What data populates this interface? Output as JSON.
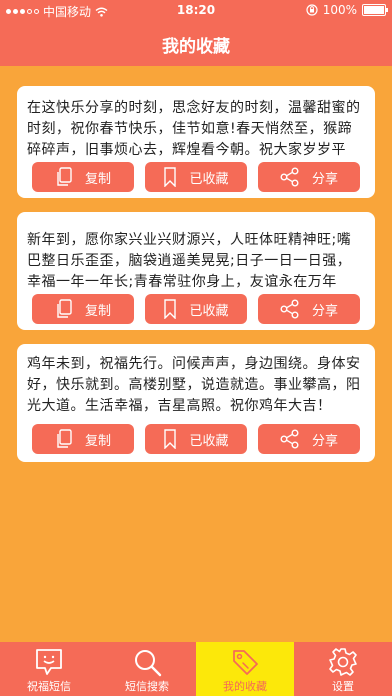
{
  "status_bar": {
    "carrier": "中国移动",
    "time": "18:20",
    "battery": "100%",
    "battery_level": 1.0
  },
  "nav": {
    "title": "我的收藏"
  },
  "cards": [
    {
      "text": "在这快乐分享的时刻，思念好友的时刻，温馨甜蜜的时刻，祝你春节快乐，佳节如意!春天悄然至，猴蹄碎碎声，旧事烦心去，辉煌看今朝。祝大家岁岁平安！",
      "copy_label": "复制",
      "collected_label": "已收藏",
      "share_label": "分享"
    },
    {
      "text": "新年到，愿你家兴业兴财源兴，人旺体旺精神旺;嘴巴整日乐歪歪，脑袋逍遥美晃晃;日子一日一日强，幸福一年一年长;青春常驻你身上，友谊永在万年长。",
      "copy_label": "复制",
      "collected_label": "已收藏",
      "share_label": "分享"
    },
    {
      "text": " 鸡年未到，祝福先行。问候声声，身边围绕。身体安好，快乐就到。高楼别墅，说造就造。事业攀高，阳光大道。生活幸福，吉星高照。祝你鸡年大吉！",
      "copy_label": "复制",
      "collected_label": "已收藏",
      "share_label": "分享"
    }
  ],
  "tabs": [
    {
      "label": "祝福短信",
      "icon": "chat-bubble-icon",
      "active": false
    },
    {
      "label": "短信搜索",
      "icon": "search-icon",
      "active": false
    },
    {
      "label": "我的收藏",
      "icon": "tag-icon",
      "active": true
    },
    {
      "label": "设置",
      "icon": "gear-icon",
      "active": false
    }
  ],
  "colors": {
    "primary": "#F56B57",
    "background": "#F9A53A",
    "active_tab": "#FCE80A"
  }
}
